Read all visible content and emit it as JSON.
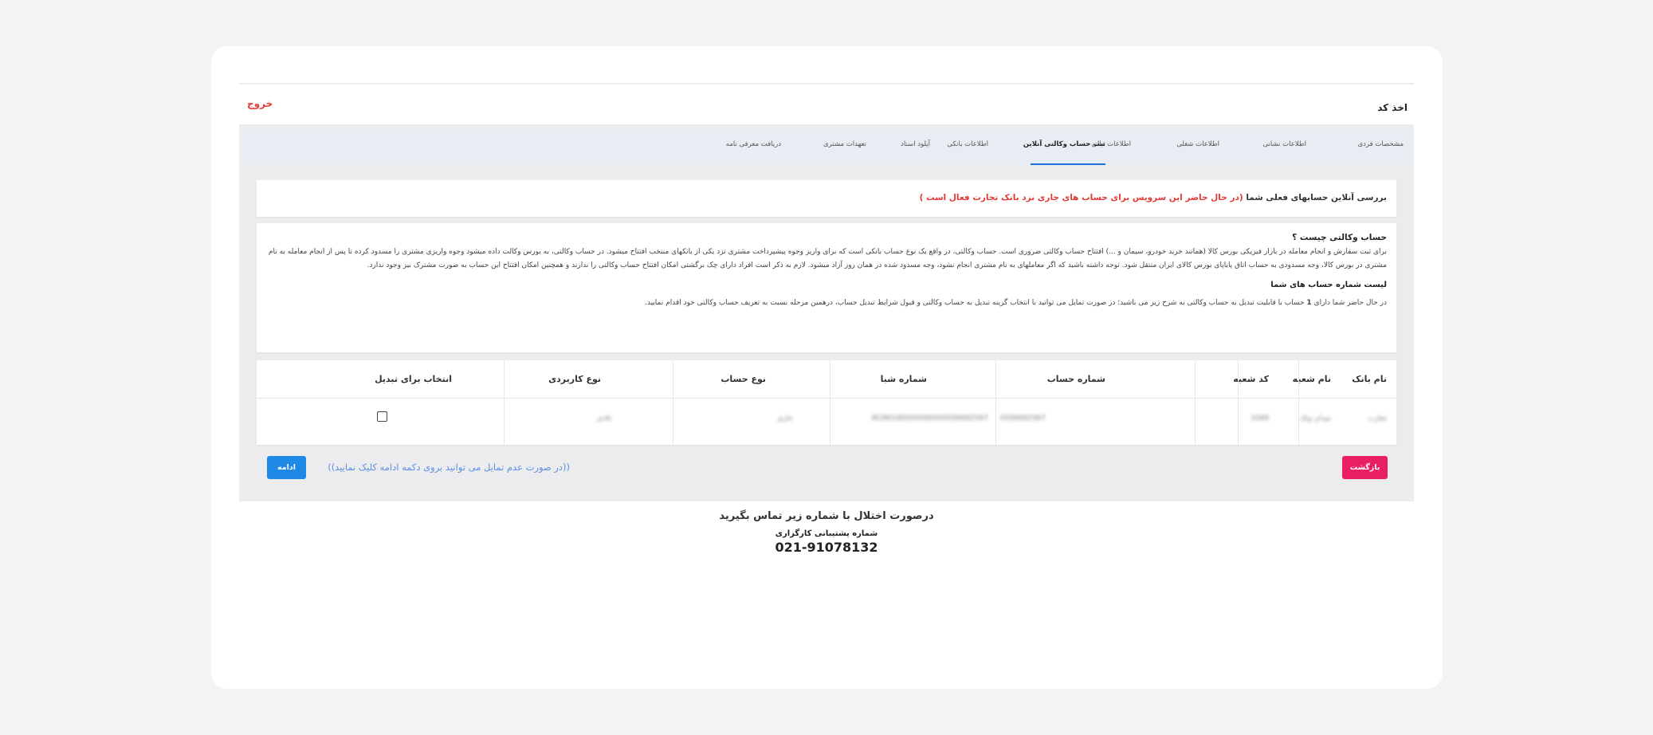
{
  "header": {
    "title": "اخذ کد",
    "logout": "خروج"
  },
  "tabs": [
    {
      "label": "مشخصات فردی"
    },
    {
      "label": "اطلاعات نشانی"
    },
    {
      "label": "اطلاعات شغلی"
    },
    {
      "label": "اطلاعات مالی"
    },
    {
      "label": "ثبت حساب وکالتی آنلاین",
      "active": true
    },
    {
      "label": "اطلاعات بانکی"
    },
    {
      "label": "آپلود اسناد"
    },
    {
      "label": "تعهدات مشتری"
    },
    {
      "label": "دریافت معرفی نامه"
    }
  ],
  "review": {
    "title": "بررسی آنلاین حسابهای فعلی شما",
    "note": "(در حال حاضر این سرویس برای حساب های جاری نزد بانک تجارت فعال است )"
  },
  "about": {
    "heading": "حساب وکالتی چیست ؟",
    "description": "برای ثبت سفارش و انجام معامله در بازار فیزیکی بورس کالا (همانند خرید خودرو، سیمان و ...) افتتاح حساب وکالتی ضروری است. حساب وکالتی، در واقع یک نوع حساب بانکی است که برای واریز وجوه پیشپرداخت مشتری نزد یکی از بانکهای منتخب افتتاح میشود. در حساب وکالتی، به بورس وکالت داده میشود وجوه واریزی مشتری را مسدود کرده تا پس از انجام معامله به نام مشتری در بورس کالا، وجه مسدودی به حساب اتاق پایاپای بورس کالای ایران منتقل شود. توجه داشته باشید که اگر معاملهای به نام مشتری انجام نشود، وجه مسدود شده در همان روز آزاد میشود. لازم به ذکر است افراد دارای چک برگشتی امکان افتتاح حساب وکالتی را ندارند و همچنین امکان افتتاح این حساب به صورت مشترک نیز وجود ندارد.",
    "list_heading": "لیست شماره حساب های شما",
    "info_prefix": "در حال حاضر شما دارای",
    "count": "1",
    "info_suffix": "حساب با قابلیت تبدیل به حساب وکالتی به شرح زیر می باشید؛ در صورت تمایل می توانید با انتخاب گزینه تبدیل به حساب وکالتی و قبول شرایط تبدیل حساب، درهمین مرحله نسبت به تعریف حساب وکالتی خود اقدام نمایید."
  },
  "table": {
    "headers": [
      "نام بانک",
      "نام شعبه",
      "کد شعبه",
      "شماره حساب",
      "شماره شبا",
      "نوع حساب",
      "نوع کاربردی",
      "انتخاب برای تبدیل"
    ],
    "row": {
      "bank": "تجارت",
      "branch": "میدان ونک",
      "branch_code": "1049",
      "account": "0556692567",
      "sheba": "IR280180000000000556692567",
      "type": "جاری",
      "usage": "عادی"
    }
  },
  "actions": {
    "back": "بازگشت",
    "continue": "ادامه",
    "hint": "((در صورت عدم تمایل می توانید بروی دکمه ادامه کلیک نمایید))"
  },
  "footer": {
    "line1": "درصورت اختلال با شماره زیر تماس بگیرید",
    "line2": "شماره پشتیبانی کارگزاری",
    "phone": "021-91078132"
  }
}
